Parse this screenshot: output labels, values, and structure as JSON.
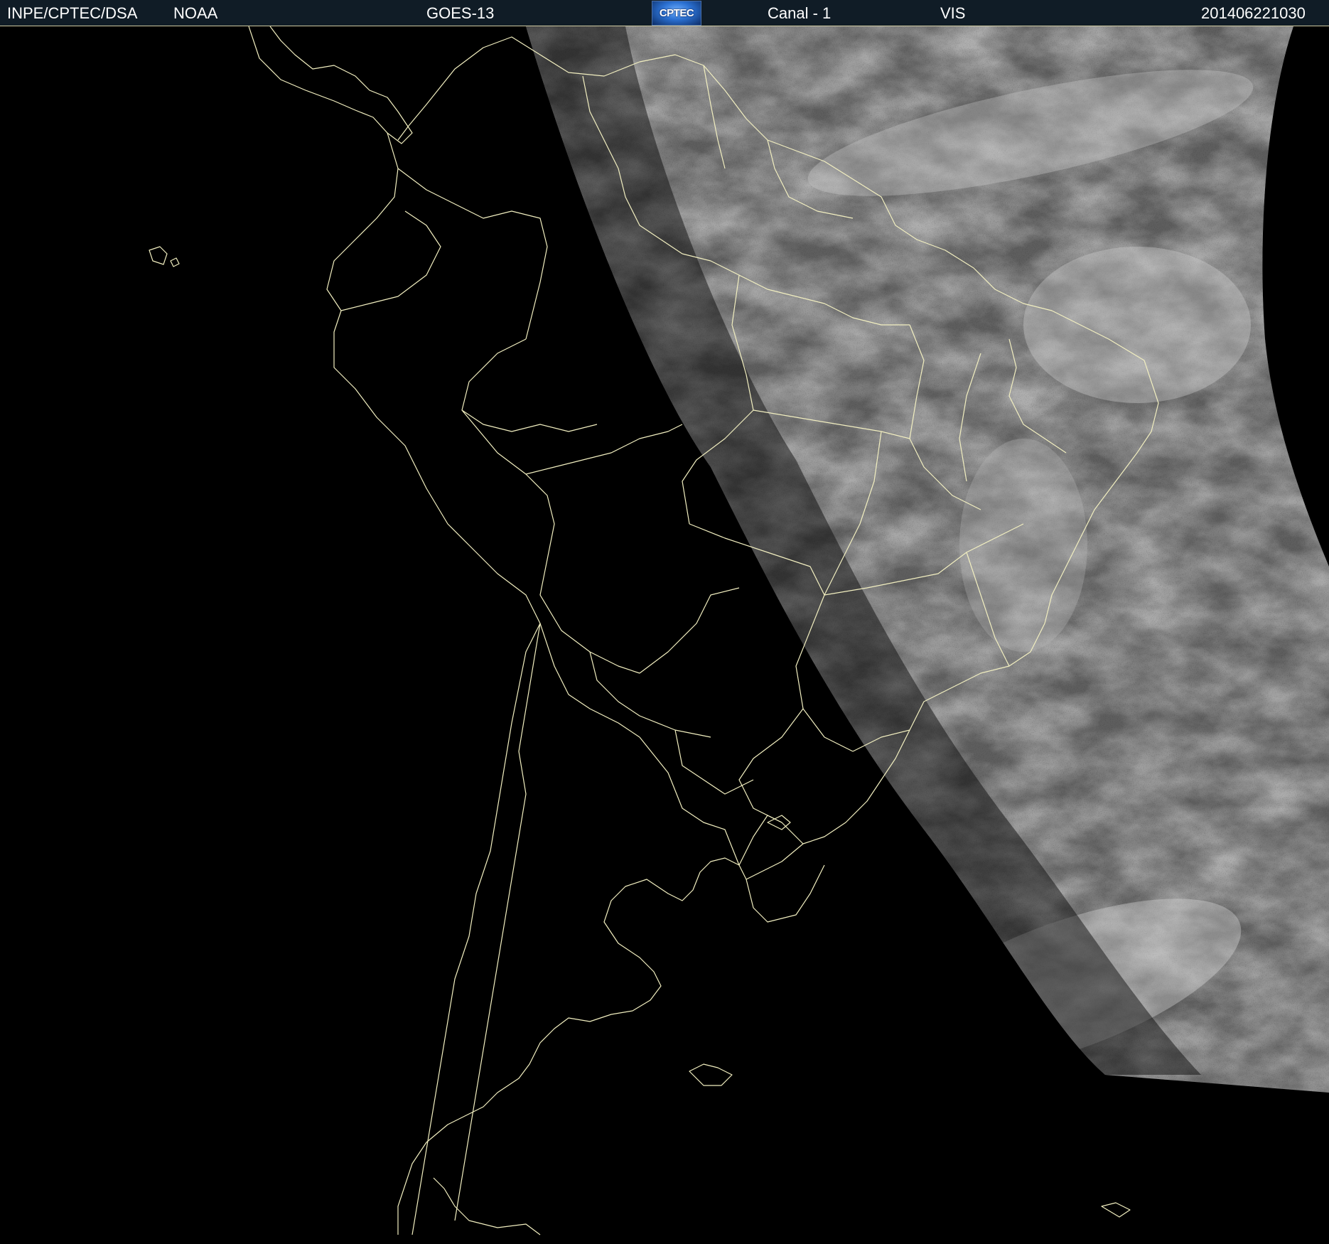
{
  "header": {
    "agency": "INPE/CPTEC/DSA",
    "partner": "NOAA",
    "satellite": "GOES-13",
    "logo_text": "CPTEC",
    "channel": "Canal - 1",
    "band": "VIS",
    "timestamp": "201406221030"
  },
  "colors": {
    "header_bg": "#101c26",
    "border_lines": "#f2efc0",
    "cloud_gray": "#6b6b6b",
    "night_side": "#000000"
  },
  "map": {
    "projection": "geostationary satellite view",
    "region": "South America",
    "overlay": "country and state borders",
    "daylight_side": "east"
  }
}
